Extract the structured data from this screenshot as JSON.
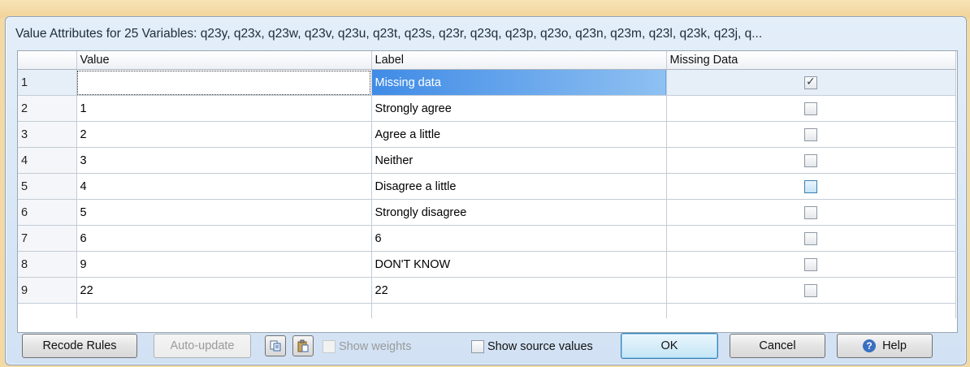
{
  "dialog": {
    "title": "Value Attributes for 25 Variables: q23y, q23x, q23w, q23v, q23u, q23t, q23s, q23r, q23q, q23p, q23o, q23n, q23m, q23l, q23k, q23j, q..."
  },
  "grid": {
    "columns": [
      "Value",
      "Label",
      "Missing Data"
    ],
    "rows": [
      {
        "num": "1",
        "value": "",
        "label": "Missing data",
        "missing": true
      },
      {
        "num": "2",
        "value": "1",
        "label": "Strongly agree",
        "missing": false
      },
      {
        "num": "3",
        "value": "2",
        "label": "Agree a little",
        "missing": false
      },
      {
        "num": "4",
        "value": "3",
        "label": "Neither",
        "missing": false
      },
      {
        "num": "5",
        "value": "4",
        "label": "Disagree a little",
        "missing": false
      },
      {
        "num": "6",
        "value": "5",
        "label": "Strongly disagree",
        "missing": false
      },
      {
        "num": "7",
        "value": "6",
        "label": "6",
        "missing": false
      },
      {
        "num": "8",
        "value": "9",
        "label": "DON'T KNOW",
        "missing": false
      },
      {
        "num": "9",
        "value": "22",
        "label": "22",
        "missing": false
      }
    ]
  },
  "buttons": {
    "recode_rules": "Recode Rules",
    "auto_update": "Auto-update",
    "ok": "OK",
    "cancel": "Cancel",
    "help": "Help"
  },
  "checkboxes": {
    "show_weights": "Show weights",
    "show_source_values": "Show source values"
  },
  "icons": {
    "copy": "copy-icon",
    "paste": "paste-icon",
    "help": "help-icon"
  }
}
